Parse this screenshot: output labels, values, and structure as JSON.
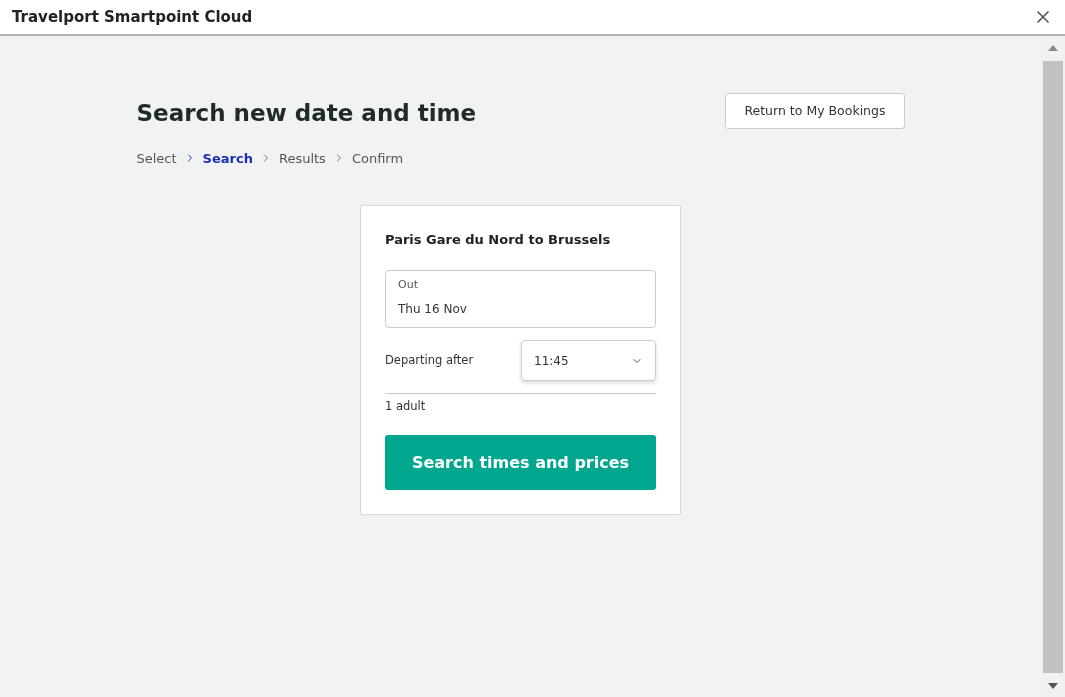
{
  "window": {
    "title": "Travelport Smartpoint Cloud"
  },
  "page": {
    "heading": "Search new date and time",
    "return_button": "Return to My Bookings"
  },
  "breadcrumb": [
    {
      "label": "Select",
      "selected": false
    },
    {
      "label": "Search",
      "selected": true
    },
    {
      "label": "Results",
      "selected": false
    },
    {
      "label": "Confirm",
      "selected": false
    }
  ],
  "card": {
    "title": "Paris Gare du Nord to Brussels",
    "out_field": {
      "label": "Out",
      "value": "Thu 16 Nov"
    },
    "departing": {
      "label": "Departing after",
      "value": "11:45"
    },
    "passengers": "1 adult",
    "search_button": "Search times and prices"
  }
}
